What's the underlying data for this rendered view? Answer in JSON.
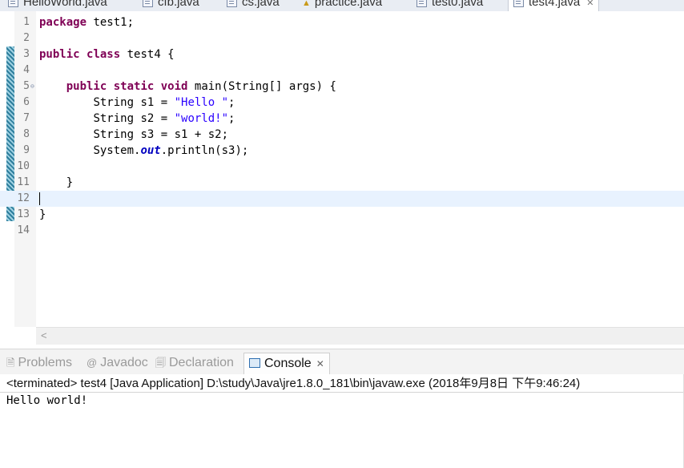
{
  "editor_tabs": [
    {
      "label": "HelloWorld.java"
    },
    {
      "label": "cfb.java"
    },
    {
      "label": "cs.java"
    },
    {
      "label": "practice.java"
    },
    {
      "label": "test0.java"
    },
    {
      "label": "test4.java",
      "active": true
    }
  ],
  "code_lines": [
    {
      "n": "1"
    },
    {
      "n": "2"
    },
    {
      "n": "3"
    },
    {
      "n": "4"
    },
    {
      "n": "5"
    },
    {
      "n": "6"
    },
    {
      "n": "7"
    },
    {
      "n": "8"
    },
    {
      "n": "9"
    },
    {
      "n": "10"
    },
    {
      "n": "11"
    },
    {
      "n": "12"
    },
    {
      "n": "13"
    },
    {
      "n": "14"
    }
  ],
  "code": {
    "l1_kw": "package",
    "l1_rest": " test1;",
    "l3_kw1": "public",
    "l3_kw2": "class",
    "l3_rest": " test4 {",
    "l5_kw1": "public",
    "l5_kw2": "static",
    "l5_kw3": "void",
    "l5_rest": " main(String[] args) {",
    "l6_a": "String s1 = ",
    "l6_str": "\"Hello \"",
    "l6_b": ";",
    "l7_a": "String s2 = ",
    "l7_str": "\"world!\"",
    "l7_b": ";",
    "l8": "String s3 = s1 + s2;",
    "l9_a": "System.",
    "l9_fld": "out",
    "l9_b": ".println(s3);",
    "l11": "}",
    "l13": "}"
  },
  "view_tabs": {
    "problems": "Problems",
    "javadoc": "Javadoc",
    "declaration": "Declaration",
    "console": "Console"
  },
  "console": {
    "status": "<terminated> test4 [Java Application] D:\\study\\Java\\jre1.8.0_181\\bin\\javaw.exe (2018年9月8日 下午9:46:24)",
    "output": "Hello world!"
  },
  "icons": [
    "java-file-icon",
    "close-icon",
    "fold-collapse-icon",
    "scroll-left-icon",
    "problems-icon",
    "javadoc-icon",
    "declaration-icon",
    "console-icon"
  ],
  "colors": {
    "keyword": "#7f0055",
    "string": "#2a00ff",
    "field": "#0000c0",
    "current_line": "#e8f2fe"
  }
}
